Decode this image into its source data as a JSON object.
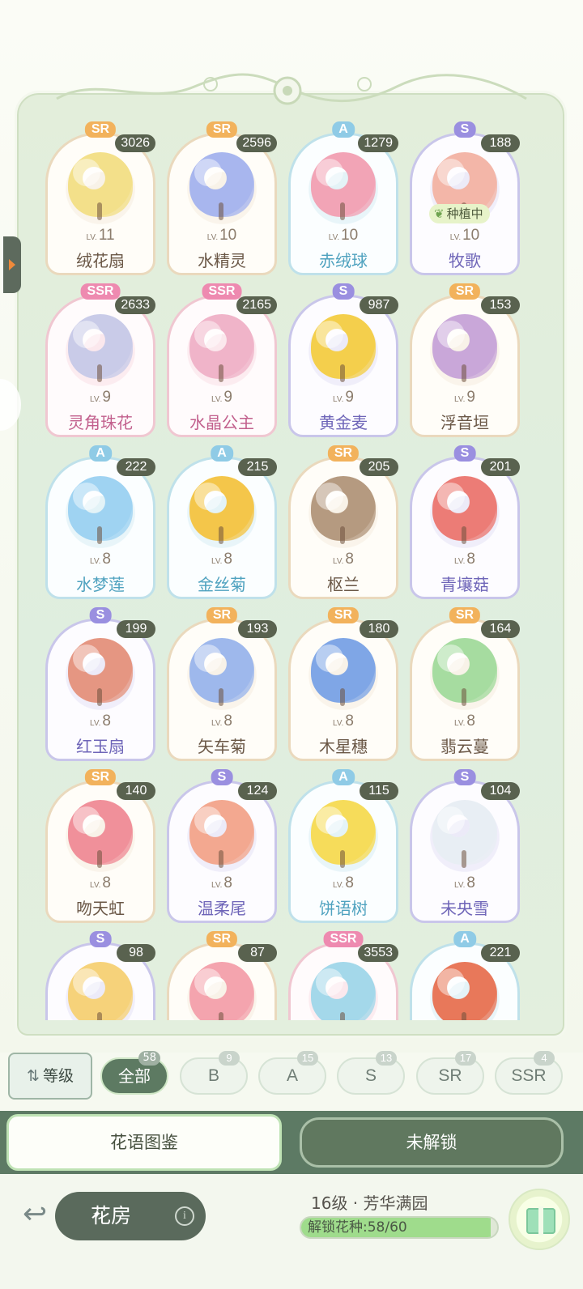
{
  "colors": {
    "frame_bg": "#e3eedb",
    "count_badge": "#59624f",
    "rarity_SR": "#f2b25c",
    "rarity_SSR": "#ee8ab0",
    "rarity_S": "#9a8fe0",
    "rarity_A": "#8fcbe6",
    "tab_bar": "#5d7a64"
  },
  "flowers": [
    {
      "rarity": "SR",
      "count": "3026",
      "lv": "11",
      "name": "绒花扇",
      "color": "#f3e08a"
    },
    {
      "rarity": "SR",
      "count": "2596",
      "lv": "10",
      "name": "水精灵",
      "color": "#a8b6ee"
    },
    {
      "rarity": "A",
      "count": "1279",
      "lv": "10",
      "name": "赤绒球",
      "color": "#f2a4b6"
    },
    {
      "rarity": "S",
      "count": "188",
      "lv": "10",
      "name": "牧歌",
      "color": "#f3b6a8",
      "status": "种植中"
    },
    {
      "rarity": "SSR",
      "count": "2633",
      "lv": "9",
      "name": "灵角珠花",
      "color": "#c9cbe8"
    },
    {
      "rarity": "SSR",
      "count": "2165",
      "lv": "9",
      "name": "水晶公主",
      "color": "#f0b4c9"
    },
    {
      "rarity": "S",
      "count": "987",
      "lv": "9",
      "name": "黄金麦",
      "color": "#f4cf4c"
    },
    {
      "rarity": "SR",
      "count": "153",
      "lv": "9",
      "name": "浮音垣",
      "color": "#c9a7d9"
    },
    {
      "rarity": "A",
      "count": "222",
      "lv": "8",
      "name": "水梦莲",
      "color": "#9fd3f2"
    },
    {
      "rarity": "A",
      "count": "215",
      "lv": "8",
      "name": "金丝菊",
      "color": "#f4c64a"
    },
    {
      "rarity": "SR",
      "count": "205",
      "lv": "8",
      "name": "枢兰",
      "color": "#b59a80"
    },
    {
      "rarity": "S",
      "count": "201",
      "lv": "8",
      "name": "青壤菇",
      "color": "#ec7c76"
    },
    {
      "rarity": "S",
      "count": "199",
      "lv": "8",
      "name": "红玉扇",
      "color": "#e59682"
    },
    {
      "rarity": "SR",
      "count": "193",
      "lv": "8",
      "name": "矢车菊",
      "color": "#9eb8ec"
    },
    {
      "rarity": "SR",
      "count": "180",
      "lv": "8",
      "name": "木星穗",
      "color": "#7fa6e6"
    },
    {
      "rarity": "SR",
      "count": "164",
      "lv": "8",
      "name": "翡云蔓",
      "color": "#a6dca0"
    },
    {
      "rarity": "SR",
      "count": "140",
      "lv": "8",
      "name": "吻天虹",
      "color": "#f0909a"
    },
    {
      "rarity": "S",
      "count": "124",
      "lv": "8",
      "name": "温柔尾",
      "color": "#f3a890"
    },
    {
      "rarity": "A",
      "count": "115",
      "lv": "8",
      "name": "饼语树",
      "color": "#f6dc5a"
    },
    {
      "rarity": "S",
      "count": "104",
      "lv": "8",
      "name": "未央雪",
      "color": "#e8eef4"
    },
    {
      "rarity": "S",
      "count": "98",
      "lv": "",
      "name": "",
      "color": "#f6d27a"
    },
    {
      "rarity": "SR",
      "count": "87",
      "lv": "",
      "name": "",
      "color": "#f4a4ae"
    },
    {
      "rarity": "SSR",
      "count": "3553",
      "lv": "",
      "name": "",
      "color": "#a4d8ea"
    },
    {
      "rarity": "A",
      "count": "221",
      "lv": "",
      "name": "",
      "color": "#e8785a"
    }
  ],
  "lv_prefix": "LV.",
  "sort_button": {
    "label": "等级",
    "icon": "sort-icon"
  },
  "filters": [
    {
      "label": "全部",
      "count": "58",
      "active": true
    },
    {
      "label": "B",
      "count": "9"
    },
    {
      "label": "A",
      "count": "15"
    },
    {
      "label": "S",
      "count": "13"
    },
    {
      "label": "SR",
      "count": "17"
    },
    {
      "label": "SSR",
      "count": "4"
    }
  ],
  "tabs": {
    "collection": "花语图鉴",
    "locked": "未解锁"
  },
  "bottom": {
    "back_icon": "back-arrow-icon",
    "room_label": "花房",
    "info_icon": "i",
    "level_title": "16级 · 芳华满园",
    "unlock_label": "解锁花种:58/60",
    "unlock_progress": 0.9667,
    "gift_icon": "gift-box-icon"
  }
}
